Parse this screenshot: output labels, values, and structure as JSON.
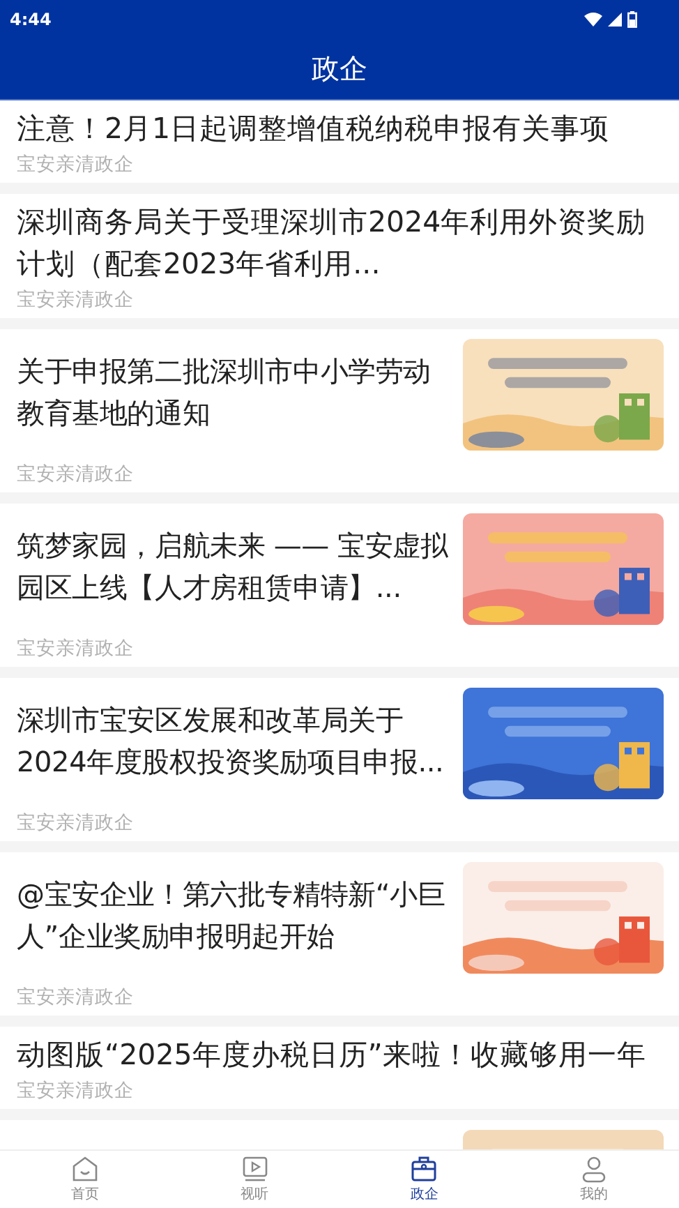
{
  "status_bar": {
    "time": "4:44"
  },
  "header": {
    "title": "政企"
  },
  "articles": [
    {
      "title": "注意！2月1日起调整增值税纳税申报有关事项",
      "source": "宝安亲清政企"
    },
    {
      "title": "深圳商务局关于受理深圳市2024年利用外资奖励计划（配套2023年省利用...",
      "source": "宝安亲清政企"
    },
    {
      "title": "关于申报第二批深圳市中小学劳动教育基地的通知",
      "source": "宝安亲清政企",
      "thumbnail": {
        "kind": "picture"
      }
    },
    {
      "title": "筑梦家园，启航未来 —— 宝安虚拟园区上线【人才房租赁申请】...",
      "source": "宝安亲清政企",
      "thumbnail": {
        "kind": "picture"
      }
    },
    {
      "title": "深圳市宝安区发展和改革局关于2024年度股权投资奖励项目申报...",
      "source": "宝安亲清政企",
      "thumbnail": {
        "kind": "picture"
      }
    },
    {
      "title": "@宝安企业！第六批专精特新“小巨人”企业奖励申报明起开始",
      "source": "宝安亲清政企",
      "thumbnail": {
        "kind": "picture"
      }
    },
    {
      "title": "动图版“2025年度办税日历”来啦！收藏够用一年",
      "source": "宝安亲清政企"
    },
    {
      "thumbnail": {
        "kind": "picture"
      }
    }
  ],
  "nav": [
    {
      "label": "首页",
      "selected": false
    },
    {
      "label": "视听",
      "selected": false
    },
    {
      "label": "政企",
      "selected": true
    },
    {
      "label": "我的",
      "selected": false
    }
  ]
}
